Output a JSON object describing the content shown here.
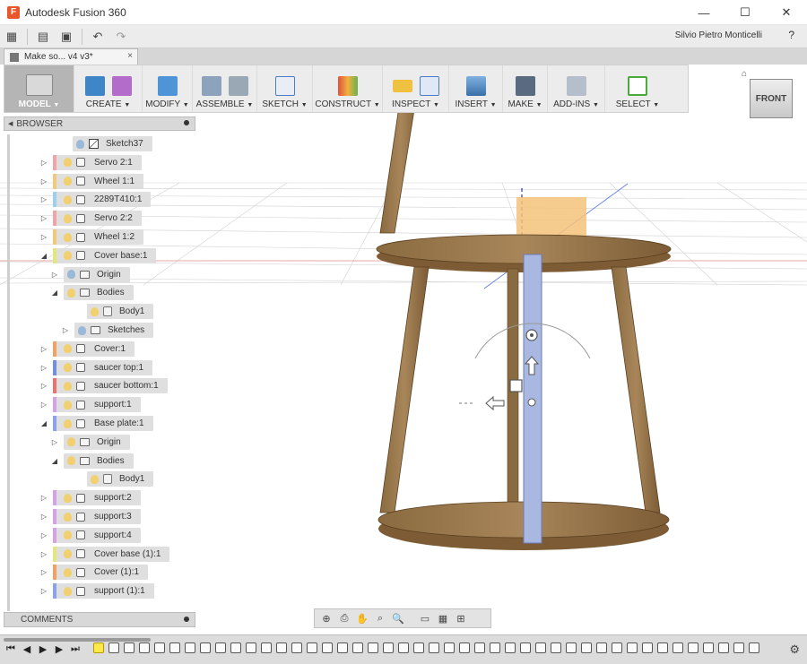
{
  "window": {
    "title": "Autodesk Fusion 360",
    "controls": [
      "—",
      "☐",
      "✕"
    ]
  },
  "user": {
    "name": "Silvio Pietro Monticelli",
    "help": "?"
  },
  "doc_tab": {
    "label": "Make so... v4 v3*",
    "close": "×"
  },
  "toolbar": {
    "groups": [
      {
        "label": "MODEL"
      },
      {
        "label": "CREATE"
      },
      {
        "label": "MODIFY"
      },
      {
        "label": "ASSEMBLE"
      },
      {
        "label": "SKETCH"
      },
      {
        "label": "CONSTRUCT"
      },
      {
        "label": "INSPECT"
      },
      {
        "label": "INSERT"
      },
      {
        "label": "MAKE"
      },
      {
        "label": "ADD-INS"
      },
      {
        "label": "SELECT"
      }
    ]
  },
  "viewcube": {
    "face": "FRONT"
  },
  "browser": {
    "title": "BROWSER",
    "items": [
      {
        "label": "Sketch37",
        "type": "sketch",
        "color": ""
      },
      {
        "label": "Servo 2:1",
        "type": "comp",
        "color": "#f2a4a4"
      },
      {
        "label": "Wheel 1:1",
        "type": "comp",
        "color": "#f5c878"
      },
      {
        "label": "2289T410:1",
        "type": "comp",
        "color": "#9ad0f0"
      },
      {
        "label": "Servo 2:2",
        "type": "comp",
        "color": "#f2a4a4"
      },
      {
        "label": "Wheel 1:2",
        "type": "comp",
        "color": "#f5c878"
      },
      {
        "label": "Cover base:1",
        "type": "comp",
        "color": "#e0e878"
      },
      {
        "label": "Origin",
        "type": "folder",
        "color": ""
      },
      {
        "label": "Bodies",
        "type": "folder",
        "color": ""
      },
      {
        "label": "Body1",
        "type": "body",
        "color": ""
      },
      {
        "label": "Sketches",
        "type": "folder",
        "color": ""
      },
      {
        "label": "Cover:1",
        "type": "comp",
        "color": "#f5a060"
      },
      {
        "label": "saucer top:1",
        "type": "comp",
        "color": "#7090e8"
      },
      {
        "label": "saucer bottom:1",
        "type": "comp",
        "color": "#f07070"
      },
      {
        "label": "support:1",
        "type": "comp",
        "color": "#d8a0e8"
      },
      {
        "label": "Base plate:1",
        "type": "comp",
        "color": "#8aa0f0"
      },
      {
        "label": "Origin",
        "type": "folder",
        "color": ""
      },
      {
        "label": "Bodies",
        "type": "folder",
        "color": ""
      },
      {
        "label": "Body1",
        "type": "body",
        "color": ""
      },
      {
        "label": "support:2",
        "type": "comp",
        "color": "#d8a0e8"
      },
      {
        "label": "support:3",
        "type": "comp",
        "color": "#d8a0e8"
      },
      {
        "label": "support:4",
        "type": "comp",
        "color": "#d8a0e8"
      },
      {
        "label": "Cover base (1):1",
        "type": "comp",
        "color": "#e0e878"
      },
      {
        "label": "Cover (1):1",
        "type": "comp",
        "color": "#f5a060"
      },
      {
        "label": "support (1):1",
        "type": "comp",
        "color": "#8aa0f0"
      }
    ]
  },
  "comments": {
    "title": "COMMENTS"
  }
}
